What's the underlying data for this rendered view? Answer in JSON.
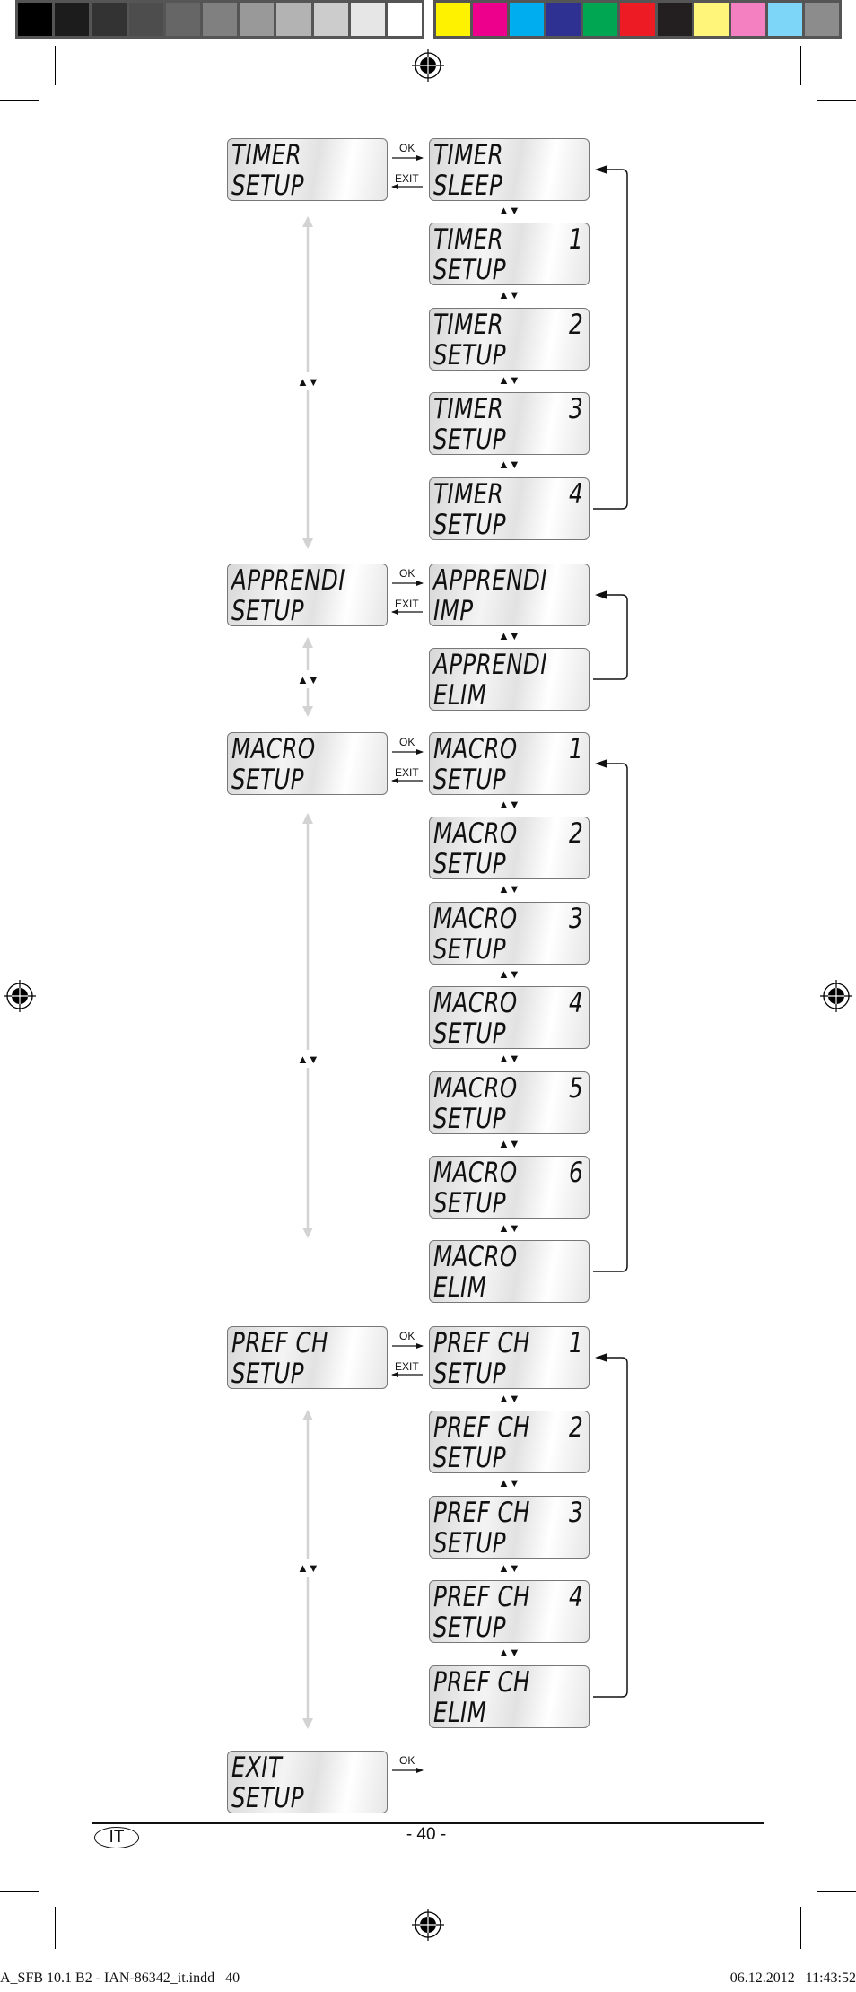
{
  "colorbar": {
    "grays": [
      "#000000",
      "#1c1c1c",
      "#333333",
      "#4d4d4d",
      "#666666",
      "#808080",
      "#999999",
      "#b3b3b3",
      "#cccccc",
      "#e6e6e6",
      "#ffffff"
    ],
    "colors": [
      "#fff200",
      "#ec008c",
      "#00aeef",
      "#2e3192",
      "#00a651",
      "#ed1c24",
      "#231f20",
      "#fff57a",
      "#f47fc1",
      "#7dd6f8",
      "#8c8c8c"
    ]
  },
  "labels": {
    "ok": "OK",
    "exit": "EXIT",
    "updown": "▲▼"
  },
  "sections": [
    {
      "id": "timer",
      "main": {
        "line1": "TIMER",
        "line2": "SETUP"
      },
      "items": [
        {
          "line1": "TIMER",
          "num": "",
          "line2": "SLEEP"
        },
        {
          "line1": "TIMER",
          "num": "1",
          "line2": "SETUP"
        },
        {
          "line1": "TIMER",
          "num": "2",
          "line2": "SETUP"
        },
        {
          "line1": "TIMER",
          "num": "3",
          "line2": "SETUP"
        },
        {
          "line1": "TIMER",
          "num": "4",
          "line2": "SETUP"
        }
      ]
    },
    {
      "id": "apprendi",
      "main": {
        "line1": "APPRENDI",
        "line2": "SETUP"
      },
      "items": [
        {
          "line1": "APPRENDI",
          "num": "",
          "line2": "IMP"
        },
        {
          "line1": "APPRENDI",
          "num": "",
          "line2": "ELIM"
        }
      ]
    },
    {
      "id": "macro",
      "main": {
        "line1": "MACRO",
        "line2": "SETUP"
      },
      "items": [
        {
          "line1": "MACRO",
          "num": "1",
          "line2": "SETUP"
        },
        {
          "line1": "MACRO",
          "num": "2",
          "line2": "SETUP"
        },
        {
          "line1": "MACRO",
          "num": "3",
          "line2": "SETUP"
        },
        {
          "line1": "MACRO",
          "num": "4",
          "line2": "SETUP"
        },
        {
          "line1": "MACRO",
          "num": "5",
          "line2": "SETUP"
        },
        {
          "line1": "MACRO",
          "num": "6",
          "line2": "SETUP"
        },
        {
          "line1": "MACRO",
          "num": "",
          "line2": "ELIM"
        }
      ]
    },
    {
      "id": "prefch",
      "main": {
        "line1": "PREF CH",
        "line2": "SETUP"
      },
      "items": [
        {
          "line1": "PREF CH",
          "num": "1",
          "line2": "SETUP"
        },
        {
          "line1": "PREF CH",
          "num": "2",
          "line2": "SETUP"
        },
        {
          "line1": "PREF CH",
          "num": "3",
          "line2": "SETUP"
        },
        {
          "line1": "PREF CH",
          "num": "4",
          "line2": "SETUP"
        },
        {
          "line1": "PREF CH",
          "num": "",
          "line2": "ELIM"
        }
      ]
    },
    {
      "id": "exit",
      "main": {
        "line1": "EXIT",
        "line2": "SETUP"
      },
      "items": []
    }
  ],
  "footer": {
    "language": "IT",
    "page": "- 40 -",
    "slug_left": "A_SFB 10.1 B2 - IAN-86342_it.indd   40",
    "slug_right": "06.12.2012   11:43:52"
  }
}
